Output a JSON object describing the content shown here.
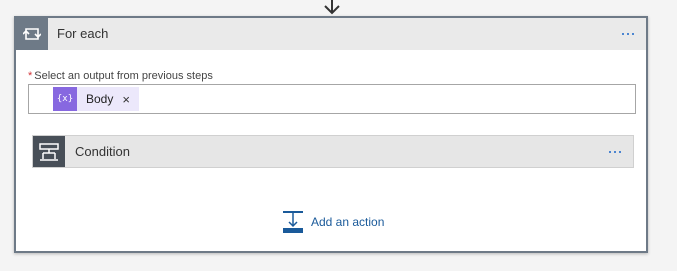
{
  "colors": {
    "accent": "#1a66c9",
    "loop_header": "#6e7a87",
    "condition_header": "#484f58",
    "token": "#8768e0",
    "required": "#d13438"
  },
  "flow_arrow": {
    "icon": "arrow-down-icon"
  },
  "for_each": {
    "title": "For each",
    "icon": "loop-icon",
    "more_icon": "more-icon",
    "field": {
      "required_marker": "*",
      "label": "Select an output from previous steps",
      "token": {
        "icon": "expression-icon",
        "icon_text": "{x}",
        "label": "Body",
        "remove": "×"
      }
    },
    "condition": {
      "title": "Condition",
      "icon": "condition-icon",
      "more_icon": "more-icon"
    },
    "add_action": {
      "label": "Add an action",
      "icon": "add-action-icon"
    }
  }
}
